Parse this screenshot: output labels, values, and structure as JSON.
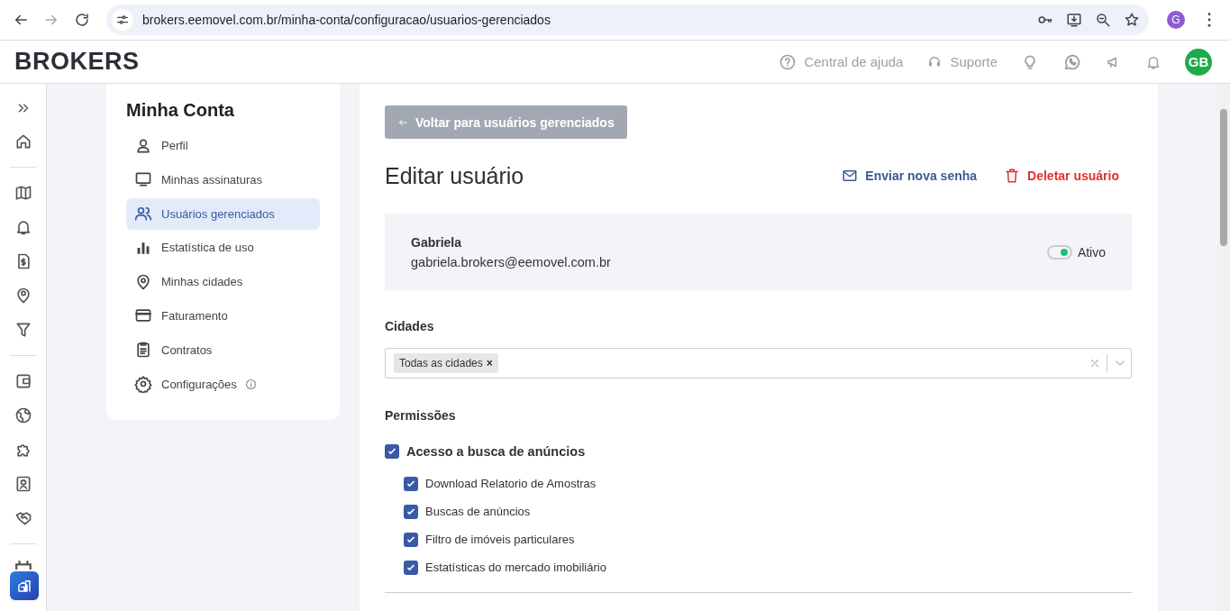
{
  "browser": {
    "url": "brokers.eemovel.com.br/minha-conta/configuracao/usuarios-gerenciados",
    "profile_initial": "G"
  },
  "header": {
    "logo": "BROKERS",
    "help": "Central de ajuda",
    "support": "Suporte",
    "avatar_initials": "GB"
  },
  "menu": {
    "title": "Minha Conta",
    "items": [
      {
        "label": "Perfil",
        "selected": false
      },
      {
        "label": "Minhas assinaturas",
        "selected": false
      },
      {
        "label": "Usuários gerenciados",
        "selected": true
      },
      {
        "label": "Estatística de uso",
        "selected": false
      },
      {
        "label": "Minhas cidades",
        "selected": false
      },
      {
        "label": "Faturamento",
        "selected": false
      },
      {
        "label": "Contratos",
        "selected": false
      },
      {
        "label": "Configurações",
        "selected": false,
        "info": true
      }
    ]
  },
  "back_button": "Voltar para usuários gerenciados",
  "title": "Editar usuário",
  "actions": {
    "send_password": "Enviar nova senha",
    "delete": "Deletar usuário"
  },
  "user": {
    "name": "Gabriela",
    "email": "gabriela.brokers@eemovel.com.br",
    "active": true,
    "status_label": "Ativo"
  },
  "cities": {
    "label": "Cidades",
    "tags": [
      "Todas as cidades"
    ],
    "remove_symbol": "×"
  },
  "permissions": {
    "label": "Permissões",
    "groups": [
      {
        "label": "Acesso a busca de anúncios",
        "checked": true,
        "children": [
          {
            "label": "Download Relatorio de Amostras",
            "checked": true
          },
          {
            "label": "Buscas de anúncios",
            "checked": true
          },
          {
            "label": "Filtro de imóveis particulares",
            "checked": true
          },
          {
            "label": "Estatísticas do mercado imobiliário",
            "checked": true
          }
        ]
      }
    ]
  }
}
